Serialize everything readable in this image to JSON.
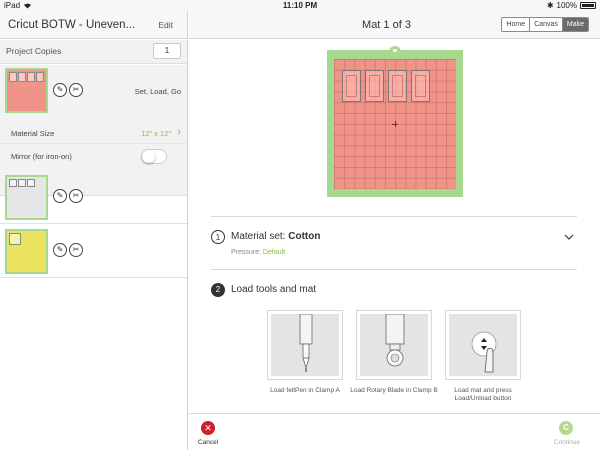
{
  "status_bar": {
    "device": "iPad",
    "time": "11:10 PM",
    "battery": "100%"
  },
  "left_header": {
    "title": "Cricut BOTW - Uneven...",
    "edit_label": "Edit"
  },
  "project_copies": {
    "label": "Project Copies",
    "value": "1"
  },
  "mats": [
    {
      "status": "Set, Load, Go",
      "color": "#f0948a",
      "pieces": 4
    },
    {
      "status": "",
      "color": "#e6e6e6",
      "pieces": 3
    },
    {
      "status": "",
      "color": "#ebe35f",
      "pieces": 1
    }
  ],
  "settings": {
    "material_size_label": "Material Size",
    "material_size_value": "12\" x 12\"",
    "mirror_label": "Mirror (for iron-on)",
    "mirror_on": false
  },
  "right_header": {
    "title": "Mat 1 of 3",
    "tabs": [
      "Home",
      "Canvas",
      "Make"
    ],
    "active_tab": "Make"
  },
  "step1": {
    "number": "1",
    "label": "Material set:",
    "material": "Cotton",
    "pressure_label": "Pressure:",
    "pressure_value": "Default"
  },
  "step2": {
    "number": "2",
    "label": "Load tools and mat",
    "cards": [
      {
        "caption": "Load feltPen in Clamp A"
      },
      {
        "caption": "Load Rotary Blade in Clamp B"
      },
      {
        "caption": "Load mat and press Load/Unload button"
      }
    ]
  },
  "footer": {
    "cancel_label": "Cancel",
    "continue_label": "Continue"
  },
  "colors": {
    "accent_green": "#7dc142",
    "mat_green": "#a6d98d",
    "cancel_red": "#d0202a"
  }
}
